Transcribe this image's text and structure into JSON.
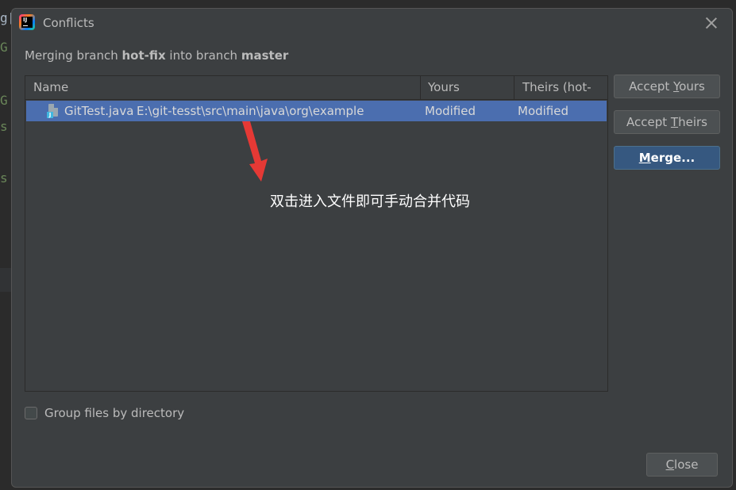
{
  "dialog": {
    "title": "Conflicts",
    "subtitle": {
      "prefix": "Merging branch ",
      "source_branch": "hot-fix",
      "middle": " into branch ",
      "target_branch": "master"
    }
  },
  "table": {
    "headers": [
      "Name",
      "Yours (master)",
      "Theirs (hot-fix)"
    ],
    "rows": [
      {
        "file_name": "GitTest.java",
        "path": "E:\\git-tesst\\src\\main\\java\\org\\example",
        "yours": "Modified",
        "theirs": "Modified",
        "icon": "java-file-icon",
        "selected": true
      }
    ]
  },
  "annotation": {
    "text": "双击进入文件即可手动合并代码",
    "arrow_color": "#e53935"
  },
  "buttons": {
    "accept_yours": {
      "before": "Accept ",
      "mnemonic": "Y",
      "after": "ours"
    },
    "accept_theirs": {
      "before": "Accept ",
      "mnemonic": "T",
      "after": "heirs"
    },
    "merge": {
      "before": "",
      "mnemonic": "M",
      "after": "erge..."
    },
    "close": {
      "before": "",
      "mnemonic": "C",
      "after": "lose"
    }
  },
  "options": {
    "group_by_directory": {
      "label": "Group files by directory",
      "checked": false
    }
  },
  "background_editor": {
    "fragments": [
      "g[",
      "G",
      "G",
      "s",
      "s"
    ]
  },
  "colors": {
    "dialog_bg": "#3c3f41",
    "selection": "#4b6eaf",
    "primary_button": "#365880",
    "text": "#bbbbbb"
  }
}
